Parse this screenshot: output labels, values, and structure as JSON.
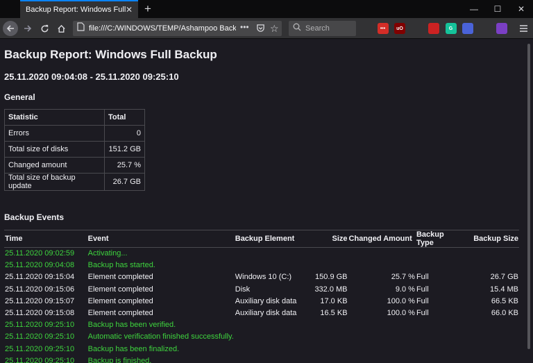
{
  "browser": {
    "tab_title": "Backup Report: Windows Full Backup",
    "url": "file:///C:/WINDOWS/TEMP/Ashampoo Backup",
    "search_placeholder": "Search"
  },
  "report": {
    "title": "Backup Report: Windows Full Backup",
    "period": "25.11.2020 09:04:08 - 25.11.2020 09:25:10",
    "general_heading": "General",
    "stats_headers": [
      "Statistic",
      "Total"
    ],
    "stats": [
      [
        "Errors",
        "0"
      ],
      [
        "Total size of disks",
        "151.2 GB"
      ],
      [
        "Changed amount",
        "25.7 %"
      ],
      [
        "Total size of backup update",
        "26.7 GB"
      ]
    ],
    "events_heading": "Backup Events",
    "event_headers": [
      "Time",
      "Event",
      "Backup Element",
      "Size",
      "Changed Amount",
      "Backup Type",
      "Backup Size"
    ],
    "events": [
      {
        "status": "info",
        "cells": [
          "25.11.2020 09:02:59",
          "Activating...",
          "",
          "",
          "",
          "",
          ""
        ]
      },
      {
        "status": "info",
        "cells": [
          "25.11.2020 09:04:08",
          "Backup has started.",
          "",
          "",
          "",
          "",
          ""
        ]
      },
      {
        "status": "normal",
        "cells": [
          "25.11.2020 09:15:04",
          "Element completed",
          "Windows 10 (C:)",
          "150.9 GB",
          "25.7 %",
          "Full",
          "26.7 GB"
        ]
      },
      {
        "status": "normal",
        "cells": [
          "25.11.2020 09:15:06",
          "Element completed",
          "Disk",
          "332.0 MB",
          "9.0 %",
          "Full",
          "15.4 MB"
        ]
      },
      {
        "status": "normal",
        "cells": [
          "25.11.2020 09:15:07",
          "Element completed",
          "Auxiliary disk data",
          "17.0 KB",
          "100.0 %",
          "Full",
          "66.5 KB"
        ]
      },
      {
        "status": "normal",
        "cells": [
          "25.11.2020 09:15:08",
          "Element completed",
          "Auxiliary disk data",
          "16.5 KB",
          "100.0 %",
          "Full",
          "66.0 KB"
        ]
      },
      {
        "status": "info",
        "cells": [
          "25.11.2020 09:25:10",
          "Backup has been verified.",
          "",
          "",
          "",
          "",
          ""
        ]
      },
      {
        "status": "info",
        "cells": [
          "25.11.2020 09:25:10",
          "Automatic verification finished successfully.",
          "",
          "",
          "",
          "",
          ""
        ]
      },
      {
        "status": "info",
        "cells": [
          "25.11.2020 09:25:10",
          "Backup has been finalized.",
          "",
          "",
          "",
          "",
          ""
        ]
      },
      {
        "status": "info",
        "cells": [
          "25.11.2020 09:25:10",
          "Backup is finished.",
          "",
          "",
          "",
          "",
          ""
        ]
      }
    ]
  },
  "colors": {
    "info_text": "#3ed43e",
    "accent": "#0a84ff"
  },
  "extensions": [
    {
      "name": "stack-icon",
      "label": "",
      "color": "#323234"
    },
    {
      "name": "lastpass-icon",
      "label": "•••",
      "color": "#d32d27"
    },
    {
      "name": "ublock-icon",
      "label": "uO",
      "color": "#800000"
    },
    {
      "name": "privacy-badger-icon",
      "label": "",
      "color": "#323234"
    },
    {
      "name": "darkreader-icon",
      "label": "",
      "color": "#cc2222"
    },
    {
      "name": "grammarly-icon",
      "label": "G",
      "color": "#15c39a"
    },
    {
      "name": "search-ext-icon",
      "label": "",
      "color": "#4a63d8"
    },
    {
      "name": "green-ext-icon",
      "label": "",
      "color": "#323234"
    },
    {
      "name": "globe-ext-icon",
      "label": "",
      "color": "#7b3fc4"
    }
  ]
}
